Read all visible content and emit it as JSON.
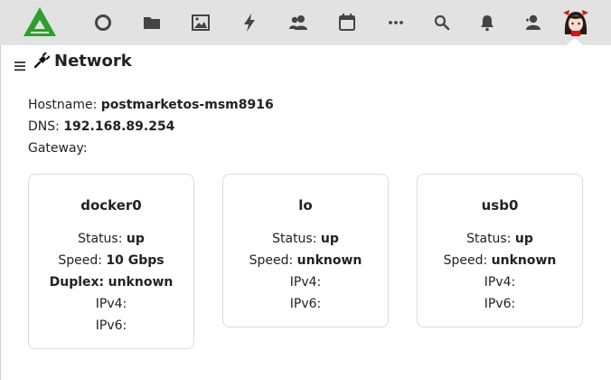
{
  "topbar": {
    "icons": [
      "app-logo-icon",
      "circle-icon",
      "folder-icon",
      "image-icon",
      "bolt-icon",
      "users-icon",
      "calendar-icon",
      "more-icon",
      "search-icon",
      "bell-icon",
      "user-icon"
    ],
    "colors": {
      "bar": "#e2e2e2",
      "logo": "#2f9e2f",
      "icon": "#444444"
    }
  },
  "page": {
    "title": "Network",
    "icon": "plug-icon"
  },
  "summary": {
    "hostname_label": "Hostname:",
    "hostname": "postmarketos-msm8916",
    "dns_label": "DNS:",
    "dns": "192.168.89.254",
    "gateway_label": "Gateway:",
    "gateway": ""
  },
  "interfaces": [
    {
      "name": "docker0",
      "status_label": "Status:",
      "status": "up",
      "speed_label": "Speed:",
      "speed": "10 Gbps",
      "duplex_label": "Duplex:",
      "duplex": "unknown",
      "ipv4_label": "IPv4:",
      "ipv6_label": "IPv6:"
    },
    {
      "name": "lo",
      "status_label": "Status:",
      "status": "up",
      "speed_label": "Speed:",
      "speed": "unknown",
      "ipv4_label": "IPv4:",
      "ipv6_label": "IPv6:"
    },
    {
      "name": "usb0",
      "status_label": "Status:",
      "status": "up",
      "speed_label": "Speed:",
      "speed": "unknown",
      "ipv4_label": "IPv4:",
      "ipv6_label": "IPv6:"
    }
  ]
}
